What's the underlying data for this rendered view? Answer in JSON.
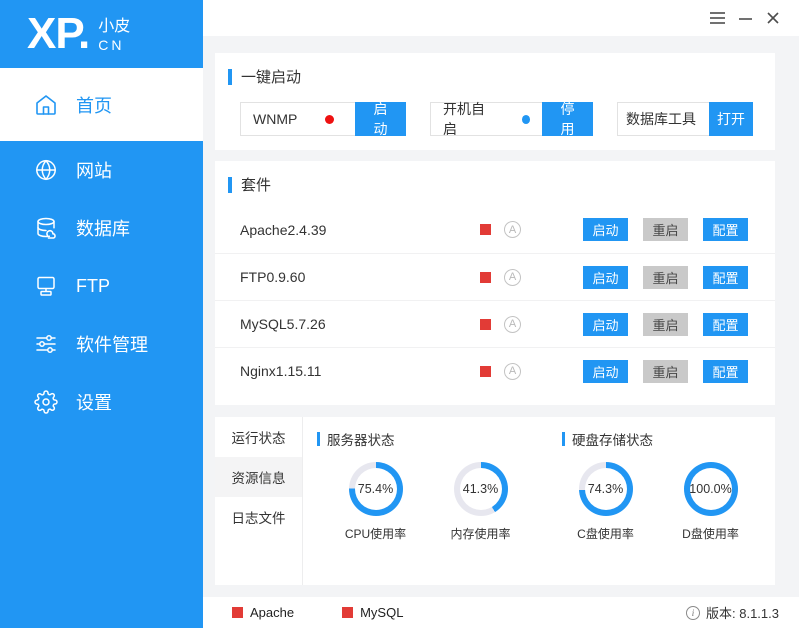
{
  "colors": {
    "accent": "#2196f3",
    "stopped_square": "#e23b36",
    "dot_red": "#ee1111",
    "dot_blue": "#2196f3",
    "donut_track": "#e7e7ef"
  },
  "window": {
    "controls": {
      "menu": "menu",
      "minimize": "minimize",
      "close": "close"
    }
  },
  "sidebar": {
    "logo": {
      "main": "XP.",
      "sub_top": "小皮",
      "sub_bottom": "CN"
    },
    "items": [
      {
        "label": "首页",
        "icon": "home-icon",
        "active": true
      },
      {
        "label": "网站",
        "icon": "globe-icon",
        "active": false
      },
      {
        "label": "数据库",
        "icon": "database-icon",
        "active": false
      },
      {
        "label": "FTP",
        "icon": "monitor-icon",
        "active": false
      },
      {
        "label": "软件管理",
        "icon": "sliders-icon",
        "active": false
      },
      {
        "label": "设置",
        "icon": "gear-icon",
        "active": false
      }
    ]
  },
  "quick_start": {
    "title": "一键启动",
    "groups": [
      {
        "label": "WNMP",
        "dot": "#ee1111",
        "button": "启动"
      },
      {
        "label": "开机自启",
        "dot": "#2196f3",
        "button": "停用"
      },
      {
        "label": "数据库工具",
        "button": "打开"
      }
    ]
  },
  "suite": {
    "title": "套件",
    "auto_badge": "A",
    "rows": [
      {
        "name": "Apache2.4.39",
        "status_color": "#e23b36",
        "buttons": [
          "启动",
          "重启",
          "配置"
        ]
      },
      {
        "name": "FTP0.9.60",
        "status_color": "#e23b36",
        "buttons": [
          "启动",
          "重启",
          "配置"
        ]
      },
      {
        "name": "MySQL5.7.26",
        "status_color": "#e23b36",
        "buttons": [
          "启动",
          "重启",
          "配置"
        ]
      },
      {
        "name": "Nginx1.15.11",
        "status_color": "#e23b36",
        "buttons": [
          "启动",
          "重启",
          "配置"
        ]
      }
    ]
  },
  "status_panel": {
    "tabs": [
      {
        "label": "运行状态",
        "selected": false
      },
      {
        "label": "资源信息",
        "selected": true
      },
      {
        "label": "日志文件",
        "selected": false
      }
    ],
    "server_status": {
      "title": "服务器状态",
      "gauges": [
        {
          "percent": 75.4,
          "display": "75.4%",
          "label": "CPU使用率"
        },
        {
          "percent": 41.3,
          "display": "41.3%",
          "label": "内存使用率"
        }
      ]
    },
    "disk_status": {
      "title": "硬盘存储状态",
      "gauges": [
        {
          "percent": 74.3,
          "display": "74.3%",
          "label": "C盘使用率"
        },
        {
          "percent": 100.0,
          "display": "100.0%",
          "label": "D盘使用率"
        }
      ]
    }
  },
  "footer": {
    "services": [
      {
        "name": "Apache",
        "color": "#e23b36"
      },
      {
        "name": "MySQL",
        "color": "#e23b36"
      }
    ],
    "version": {
      "icon": "i",
      "label": "版本: 8.1.1.3"
    }
  },
  "chart_data": {
    "type": "pie",
    "title": "资源使用率仪表",
    "series": [
      {
        "name": "CPU使用率",
        "value": 75.4
      },
      {
        "name": "内存使用率",
        "value": 41.3
      },
      {
        "name": "C盘使用率",
        "value": 74.3
      },
      {
        "name": "D盘使用率",
        "value": 100.0
      }
    ]
  }
}
